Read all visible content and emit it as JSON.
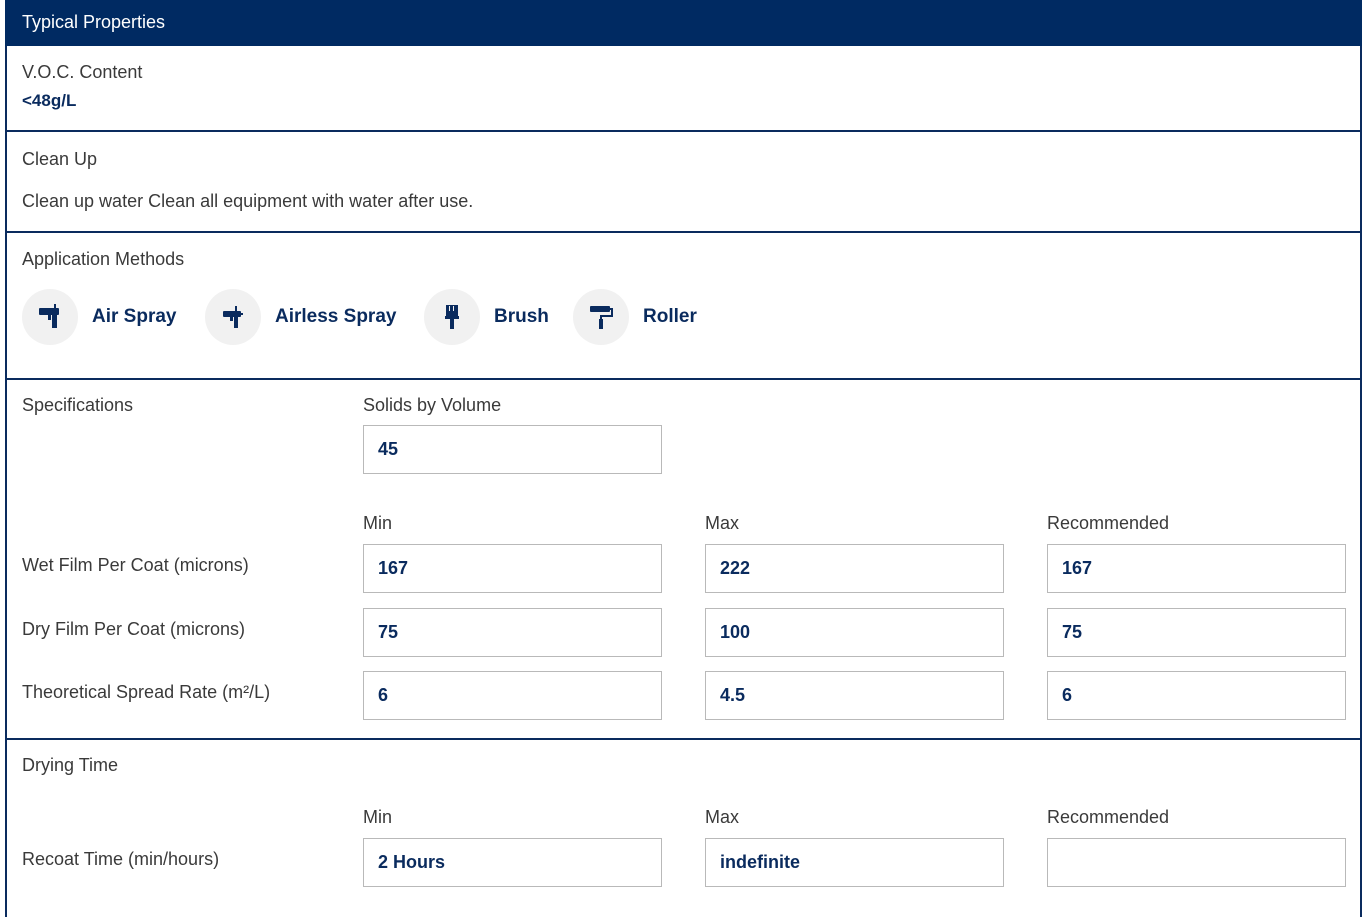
{
  "header": {
    "title": "Typical Properties"
  },
  "voc": {
    "label": "V.O.C. Content",
    "value": "<48g/L"
  },
  "cleanup": {
    "label": "Clean Up",
    "text": "Clean up water Clean all equipment with water after use."
  },
  "application": {
    "label": "Application Methods",
    "methods": [
      {
        "label": "Air Spray",
        "icon": "air-spray-gun-icon"
      },
      {
        "label": "Airless Spray",
        "icon": "airless-spray-gun-icon"
      },
      {
        "label": "Brush",
        "icon": "paint-brush-icon"
      },
      {
        "label": "Roller",
        "icon": "paint-roller-icon"
      }
    ]
  },
  "specifications": {
    "label": "Specifications",
    "solids_label": "Solids by Volume",
    "solids_value": "45",
    "columns": {
      "min": "Min",
      "max": "Max",
      "recommended": "Recommended"
    },
    "rows": [
      {
        "label": "Wet Film Per Coat (microns)",
        "min": "167",
        "max": "222",
        "recommended": "167"
      },
      {
        "label": "Dry Film Per Coat (microns)",
        "min": "75",
        "max": "100",
        "recommended": "75"
      },
      {
        "label": "Theoretical Spread Rate (m²/L)",
        "min": "6",
        "max": "4.5",
        "recommended": "6"
      }
    ]
  },
  "drying": {
    "label": "Drying Time",
    "columns": {
      "min": "Min",
      "max": "Max",
      "recommended": "Recommended"
    },
    "rows": [
      {
        "label": "Recoat Time (min/hours)",
        "min": "2 Hours",
        "max": "indefinite",
        "recommended": ""
      }
    ]
  },
  "colors": {
    "navy": "#002a62",
    "text": "#3a3a3a",
    "field_border": "#b9b9b9",
    "icon_bg": "#f1f1f1"
  }
}
